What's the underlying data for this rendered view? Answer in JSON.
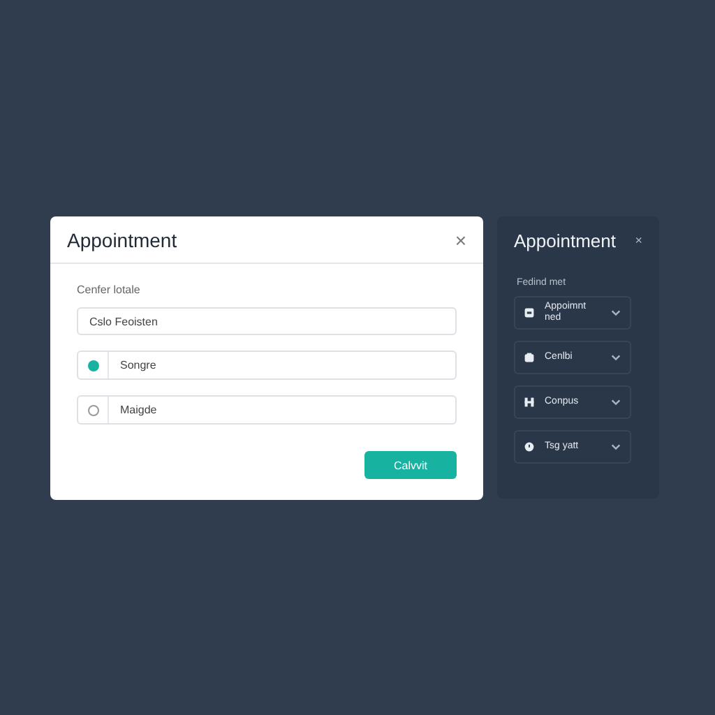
{
  "dialog": {
    "title": "Appointment",
    "close": "×",
    "label": "Cenfer lotale",
    "input": {
      "value": "Cslo Feoisten"
    },
    "options": [
      {
        "label": "Songre",
        "selected": true
      },
      {
        "label": "Maigde",
        "selected": false
      }
    ],
    "button": "Calvvit"
  },
  "panel": {
    "title": "Appointment",
    "close": "×",
    "label": "Fedind met",
    "dropdowns": [
      {
        "label": "Appoimnt ned"
      },
      {
        "label": "Cenlbi"
      },
      {
        "label": "Conpus"
      },
      {
        "label": "Tsg yatt"
      }
    ]
  }
}
